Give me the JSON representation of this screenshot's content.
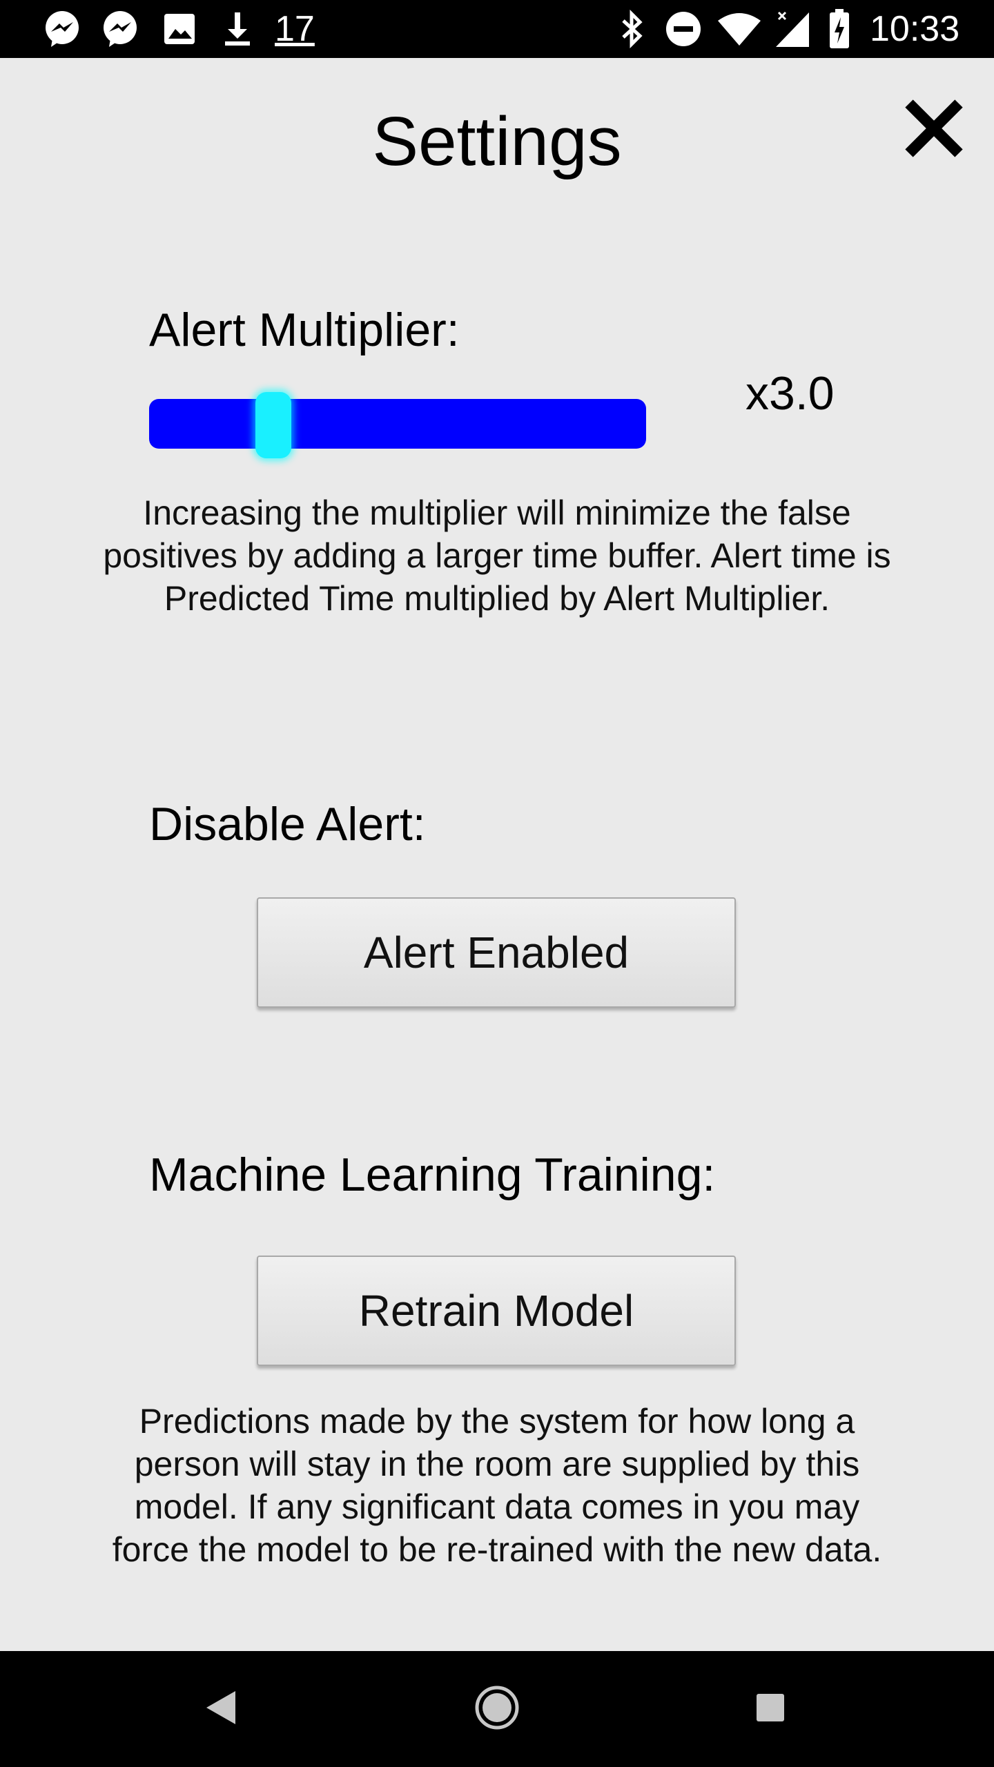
{
  "status_bar": {
    "notification_count": "17",
    "time": "10:33",
    "left_icons": [
      "messenger-icon",
      "messenger-icon",
      "image-icon",
      "download-icon"
    ],
    "right_icons": [
      "bluetooth-icon",
      "do-not-disturb-icon",
      "wifi-icon",
      "signal-icon",
      "battery-icon"
    ]
  },
  "header": {
    "title": "Settings",
    "close_icon": "close-icon"
  },
  "alert_multiplier": {
    "label": "Alert Multiplier:",
    "value_text": "x3.0",
    "slider_fraction": 0.25,
    "description": "Increasing the multiplier will minimize the false positives by adding a larger time buffer. Alert time is Predicted Time multiplied by Alert Multiplier."
  },
  "disable_alert": {
    "label": "Disable Alert:",
    "button_label": "Alert Enabled"
  },
  "ml_training": {
    "label": "Machine Learning Training:",
    "button_label": "Retrain Model",
    "description": "Predictions made by the system for how long a person will stay in the room are supplied by this model. If any significant data comes in you may force the model to be re-trained with the new data."
  },
  "colors": {
    "slider_track": "#0000ff",
    "slider_thumb": "#19f0ff",
    "background": "#eaeaea"
  },
  "nav_bar": {
    "icons": [
      "back-icon",
      "home-icon",
      "recents-icon"
    ]
  }
}
